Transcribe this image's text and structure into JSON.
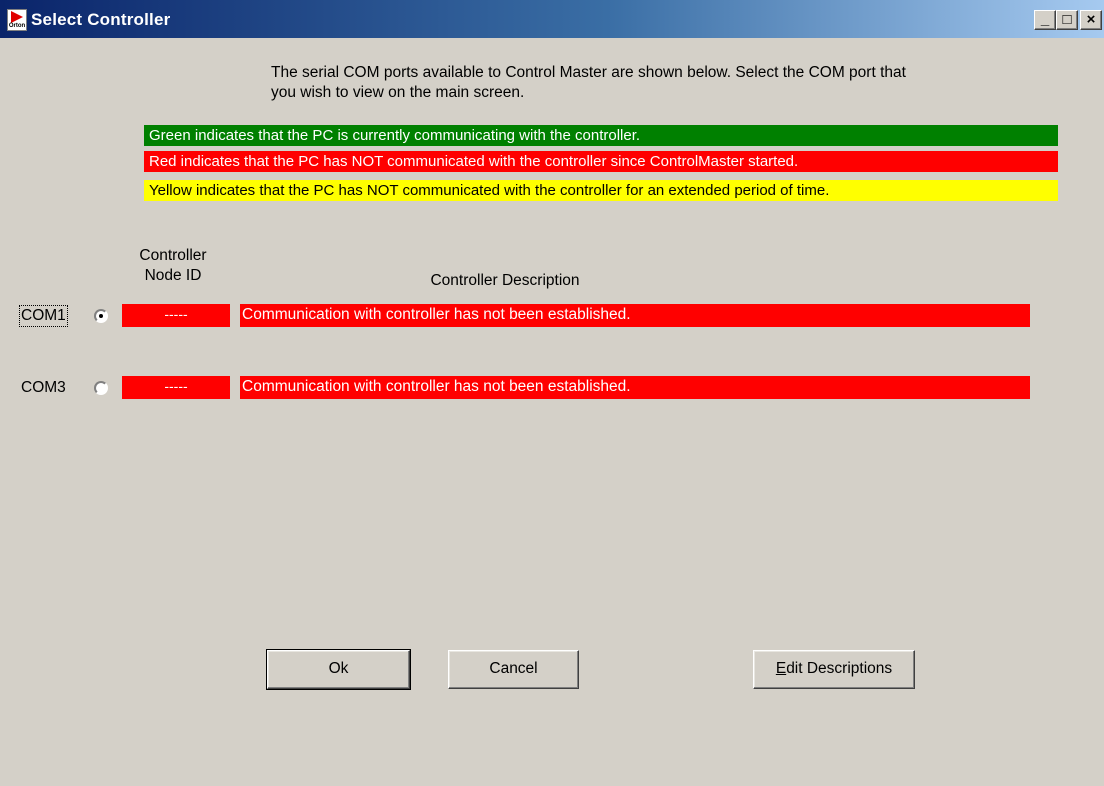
{
  "window": {
    "title": "Select Controller",
    "app_icon_text": "Orton",
    "buttons": {
      "minimize": "_",
      "maximize": "□",
      "close": "×"
    }
  },
  "instructions": "The serial COM ports available to Control Master are shown below.  Select the COM port that you wish to view on the main screen.",
  "legend": {
    "green": "Green indicates that the PC is currently communicating with the controller.",
    "red": "Red indicates that the PC has NOT communicated with the controller since ControlMaster started.",
    "yellow": "Yellow indicates that the PC has NOT communicated with the controller for an extended period of time.",
    "colors": {
      "green": "#008000",
      "red": "#ff0000",
      "yellow": "#ffff00"
    }
  },
  "columns": {
    "node_id": "Controller Node ID",
    "description": "Controller Description"
  },
  "ports": [
    {
      "label": "COM1",
      "selected": true,
      "node_id": "-----",
      "description": "Communication with controller has not been established.",
      "status": "red"
    },
    {
      "label": "COM3",
      "selected": false,
      "node_id": "-----",
      "description": "Communication with controller has not been established.",
      "status": "red"
    }
  ],
  "actions": {
    "ok": "Ok",
    "cancel": "Cancel",
    "edit_first": "E",
    "edit_rest": "dit Descriptions"
  }
}
